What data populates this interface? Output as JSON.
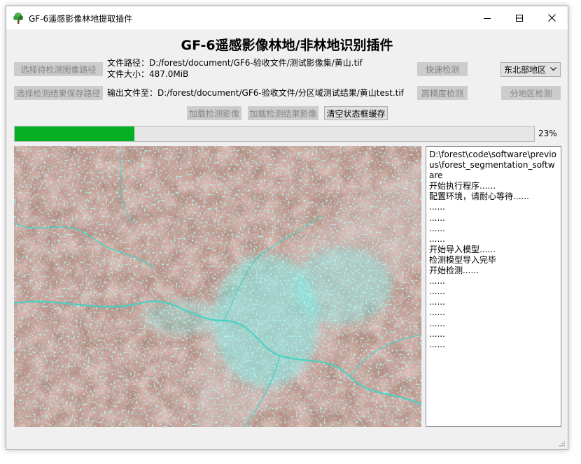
{
  "window": {
    "title": "GF-6遥感影像林地提取插件",
    "minimize_icon": "minimize-icon",
    "maximize_icon": "maximize-icon",
    "close_icon": "close-icon"
  },
  "header": {
    "title": "GF-6遥感影像林地/非林地识别插件"
  },
  "buttons": {
    "select_image_path": "选择待检测图像路径",
    "select_result_path": "选择检测结果保存路径",
    "quick_detect": "快速检测",
    "high_precision": "高精度检测",
    "regional_detect": "分地区检测",
    "load_image": "加载检测影像",
    "load_result": "加载检测结果影像",
    "clear_log": "清空状态框缓存"
  },
  "file_info": {
    "path_line": "文件路径：D:/forest/document/GF6-验收文件/测试影像集/黄山.tif",
    "size_line": "文件大小：487.0MiB",
    "output_line": "输出文件至：D:/forest/document/GF6-验收文件/分区域测试结果/黄山test.tif"
  },
  "region_select": {
    "selected": "东北部地区"
  },
  "progress": {
    "value": 0.23,
    "label": "23%"
  },
  "log": {
    "lines": [
      "D:\\forest\\code\\software\\previous\\forest_segmentation_software",
      "开始执行程序......",
      "配置环境，请耐心等待......",
      "......",
      "......",
      "......",
      "......",
      "开始导入模型......",
      "检测模型导入完毕",
      "开始检测......",
      "......",
      "......",
      "......",
      "......",
      "......",
      "......",
      "......"
    ]
  },
  "colors": {
    "progress_green": "#06b025",
    "window_bg": "#f0f0f0",
    "button_disabled_bg": "#cccccc",
    "button_disabled_text": "#838383",
    "satellite_red": "#c98a7e",
    "satellite_cyan": "#5ff5ec"
  }
}
